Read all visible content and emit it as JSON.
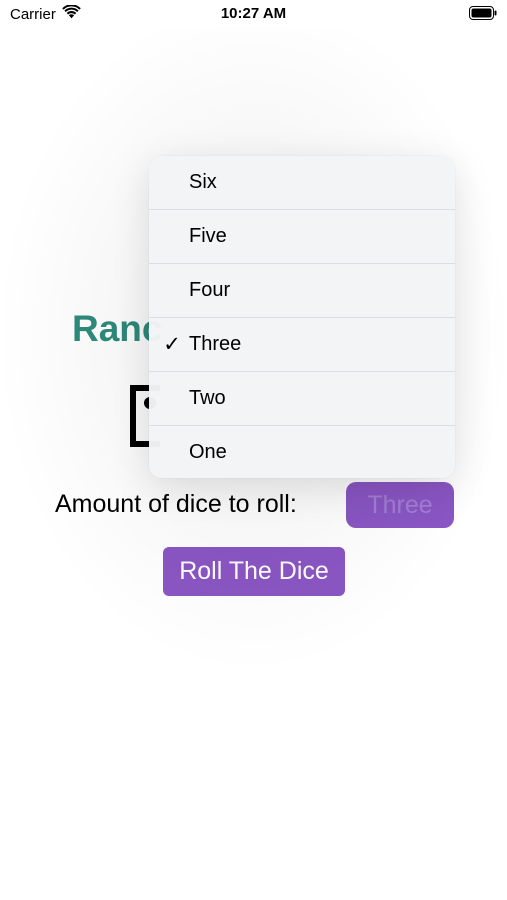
{
  "status_bar": {
    "carrier": "Carrier",
    "time": "10:27 AM",
    "wifi_icon": "wifi-icon",
    "battery_icon": "battery-icon"
  },
  "page": {
    "title": "Ranc",
    "dice_icon": "die-icon",
    "amount_label": "Amount of dice to roll:",
    "selected_amount": "Three",
    "roll_button_label": "Roll The Dice"
  },
  "menu": {
    "items": [
      {
        "label": "Six",
        "checked": false,
        "check": ""
      },
      {
        "label": "Five",
        "checked": false,
        "check": ""
      },
      {
        "label": "Four",
        "checked": false,
        "check": ""
      },
      {
        "label": "Three",
        "checked": true,
        "check": "✓"
      },
      {
        "label": "Two",
        "checked": false,
        "check": ""
      },
      {
        "label": "One",
        "checked": false,
        "check": ""
      }
    ]
  },
  "colors": {
    "title": "#2e8b7d",
    "button_bg": "#8a56c4",
    "button_text": "#ffffff",
    "select_text": "#a37fd6",
    "menu_bg": "#f3f4f5"
  }
}
